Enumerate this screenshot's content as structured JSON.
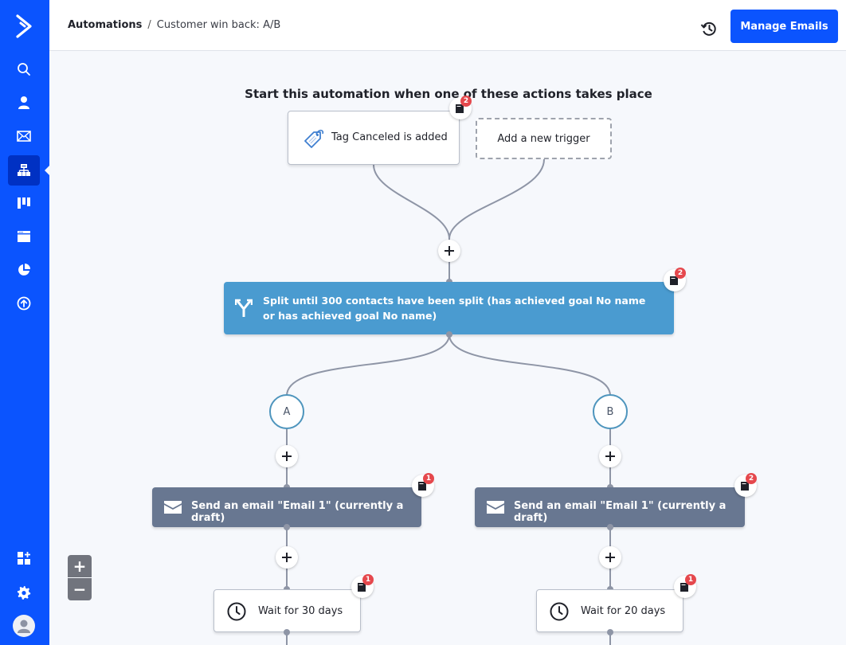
{
  "app": {
    "brand_color": "#0b54fe",
    "nav_items": [
      {
        "id": "search",
        "icon": "search-icon",
        "active": false
      },
      {
        "id": "contacts",
        "icon": "person-icon",
        "active": false
      },
      {
        "id": "campaigns",
        "icon": "envelope-icon",
        "active": false
      },
      {
        "id": "automations",
        "icon": "sitemap-icon",
        "active": true
      },
      {
        "id": "deals",
        "icon": "pipeline-icon",
        "active": false
      },
      {
        "id": "website",
        "icon": "browser-window-icon",
        "active": false
      },
      {
        "id": "reports",
        "icon": "pie-chart-icon",
        "active": false
      },
      {
        "id": "upgrade",
        "icon": "arrow-up-circle-icon",
        "active": false
      }
    ],
    "bottom_nav": [
      {
        "id": "apps",
        "icon": "apps-add-icon"
      },
      {
        "id": "settings",
        "icon": "gear-icon"
      },
      {
        "id": "profile",
        "icon": "avatar-icon"
      }
    ]
  },
  "header": {
    "breadcrumb_root": "Automations",
    "breadcrumb_separator": "/",
    "breadcrumb_current": "Customer win back: A/B",
    "history_icon": "history-icon",
    "manage_emails_label": "Manage Emails"
  },
  "canvas": {
    "trigger_title": "Start this automation when one of these actions takes place",
    "triggers": [
      {
        "label": "Tag Canceled is added",
        "icon": "tag-icon",
        "notes": "2"
      },
      {
        "label": "Add a new trigger"
      }
    ],
    "split": {
      "label": "Split until 300 contacts have been split (has achieved goal No name or has achieved goal No name)",
      "icon": "split-icon",
      "notes": "2"
    },
    "branches": [
      {
        "name": "A",
        "email": {
          "label": "Send an email \"Email 1\" (currently a draft)",
          "notes": "1"
        },
        "wait": {
          "label": "Wait for 30 days",
          "notes": "1"
        }
      },
      {
        "name": "B",
        "email": {
          "label": "Send an email \"Email 1\" (currently a draft)",
          "notes": "2"
        },
        "wait": {
          "label": "Wait for 20 days",
          "notes": "1"
        }
      }
    ],
    "add_step_symbol": "+",
    "zoom_in": "+",
    "zoom_out": "−"
  }
}
